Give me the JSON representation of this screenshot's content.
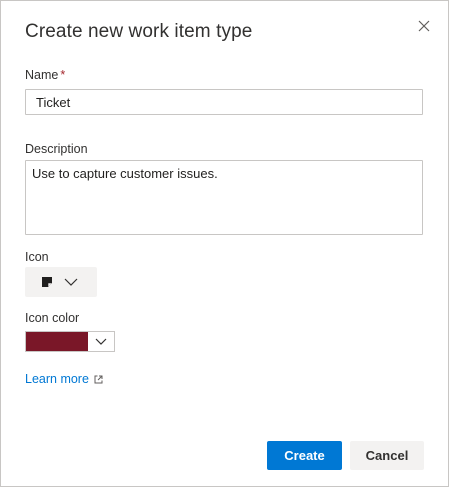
{
  "dialog": {
    "title": "Create new work item type",
    "close_icon": "close-icon"
  },
  "form": {
    "name": {
      "label": "Name",
      "required_marker": "*",
      "value": "Ticket"
    },
    "description": {
      "label": "Description",
      "value": "Use to capture customer issues."
    },
    "icon": {
      "label": "Icon",
      "selected_icon": "work-item-icon",
      "dropdown_icon": "chevron-down-icon"
    },
    "icon_color": {
      "label": "Icon color",
      "selected_color": "#7a1728",
      "dropdown_icon": "chevron-down-icon"
    },
    "learn_more": {
      "label": "Learn more",
      "icon": "external-link-icon"
    }
  },
  "footer": {
    "create_label": "Create",
    "cancel_label": "Cancel"
  },
  "colors": {
    "primary": "#0078d4",
    "border": "#c8c6c4",
    "required": "#a4262c"
  }
}
